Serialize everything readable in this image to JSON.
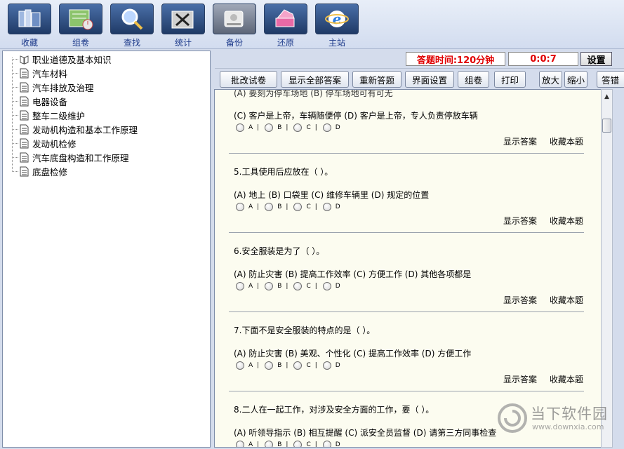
{
  "toolbar": {
    "items": [
      {
        "label": "收藏",
        "icon": "collect-icon"
      },
      {
        "label": "组卷",
        "icon": "compose-icon"
      },
      {
        "label": "查找",
        "icon": "search-icon"
      },
      {
        "label": "统计",
        "icon": "stats-icon"
      },
      {
        "label": "备份",
        "icon": "backup-icon"
      },
      {
        "label": "还原",
        "icon": "restore-icon"
      },
      {
        "label": "主站",
        "icon": "ie-icon"
      }
    ]
  },
  "tree": {
    "items": [
      "职业道德及基本知识",
      "汽车材料",
      "汽车排放及治理",
      "电器设备",
      "整车二级维护",
      "发动机构造和基本工作原理",
      "发动机检修",
      "汽车底盘构造和工作原理",
      "底盘检修"
    ]
  },
  "timer": {
    "label": "答题时间:120分钟",
    "elapsed": "0:0:7",
    "settings": "设置"
  },
  "actions": {
    "grade": "批改试卷",
    "show_all": "显示全部答案",
    "redo": "重新答题",
    "ui_settings": "界面设置",
    "compose": "组卷",
    "print": "打印",
    "zoom_in": "放大",
    "zoom_out": "缩小",
    "answer_sheet": "答错"
  },
  "questions": {
    "partial_top": "(A) 要刻为停车场地  (B) 停车场地可有可无",
    "q4_options": "(C) 客户是上帝，车辆随便停  (D) 客户是上帝，专人负责停放车辆",
    "q5_title": "5.工具使用后应放在（ ）。",
    "q5_options": "(A) 地上  (B) 口袋里  (C) 维修车辆里  (D) 规定的位置",
    "q6_title": "6.安全服装是为了（ ）。",
    "q6_options": "(A) 防止灾害  (B) 提高工作效率  (C) 方便工作  (D) 其他各项都是",
    "q7_title": "7.下面不是安全服装的特点的是（ ）。",
    "q7_options": "(A) 防止灾害  (B) 美观、个性化  (C) 提高工作效率  (D) 方便工作",
    "q8_title": "8.二人在一起工作，对涉及安全方面的工作，要（ ）。",
    "q8_options": "(A) 听领导指示  (B) 相互提醒  (C) 派安全员监督  (D) 请第三方同事检查",
    "choice_a": "A",
    "choice_b": "B",
    "choice_c": "C",
    "choice_d": "D",
    "bar": "|",
    "show_answer": "显示答案",
    "bookmark": "收藏本题"
  },
  "watermark": {
    "title": "当下软件园",
    "url": "www.downxia.com"
  },
  "colors": {
    "toolbar_label": "#1d3a8a",
    "timer_text": "#e00000",
    "content_bg": "#fcfcf0"
  }
}
